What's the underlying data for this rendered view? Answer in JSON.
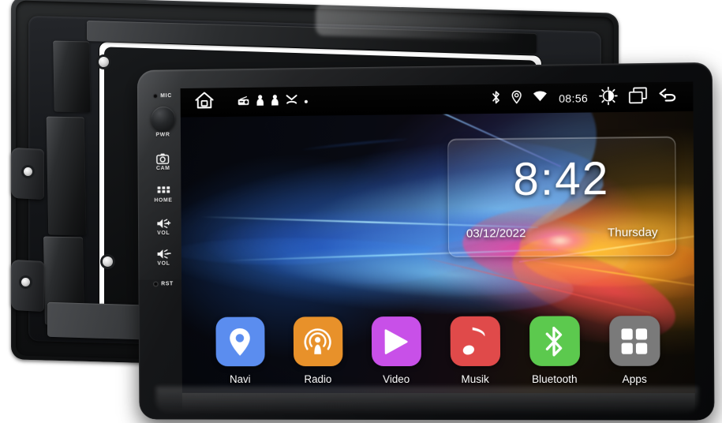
{
  "device": {
    "name": "android-car-head-unit",
    "side_keys": [
      {
        "id": "mic",
        "label": "MIC",
        "icon": "mic-hole-icon"
      },
      {
        "id": "pwr",
        "label": "PWR",
        "icon": "power-knob-icon"
      },
      {
        "id": "cam",
        "label": "CAM",
        "icon": "camera-icon"
      },
      {
        "id": "home",
        "label": "HOME",
        "icon": "grid-home-icon"
      },
      {
        "id": "volup",
        "label": "VOL",
        "icon": "volume-up-icon"
      },
      {
        "id": "voldn",
        "label": "VOL",
        "icon": "volume-down-icon"
      },
      {
        "id": "rst",
        "label": "RST",
        "icon": "reset-pinhole-icon"
      }
    ]
  },
  "status_bar": {
    "home_icon": "home-icon",
    "notifications": [
      {
        "icon": "radio-icon"
      },
      {
        "icon": "person-icon"
      },
      {
        "icon": "person-icon"
      },
      {
        "icon": "chevron-collapse-icon"
      },
      {
        "icon": "dot-icon"
      }
    ],
    "bluetooth_icon": "bluetooth-icon",
    "location_icon": "location-pin-icon",
    "wifi_icon": "wifi-icon",
    "time": "08:56",
    "brightness_icon": "brightness-icon",
    "recents_icon": "recent-apps-icon",
    "back_icon": "back-arrow-icon"
  },
  "clock_widget": {
    "time": "8:42",
    "date": "03/12/2022",
    "weekday": "Thursday"
  },
  "dock": {
    "apps": [
      {
        "label": "Navi",
        "icon": "location-pin-icon",
        "color": "#5b8def"
      },
      {
        "label": "Radio",
        "icon": "podcast-radio-icon",
        "color": "#e8912a"
      },
      {
        "label": "Video",
        "icon": "play-triangle-icon",
        "color": "#c850e8"
      },
      {
        "label": "Musik",
        "icon": "music-note-icon",
        "color": "#e04a4a"
      },
      {
        "label": "Bluetooth",
        "icon": "bluetooth-icon",
        "color": "#5cc94e"
      },
      {
        "label": "Apps",
        "icon": "app-grid-icon",
        "color": "#7a7a7a"
      }
    ]
  },
  "colors": {
    "bezel": "#0d0e10",
    "screen_bg": "#07080c",
    "status_bar_bg": "#000000",
    "accent_cyan": "#7ad4ff",
    "accent_magenta": "#ff3caa",
    "accent_amber": "#ffc23c"
  }
}
